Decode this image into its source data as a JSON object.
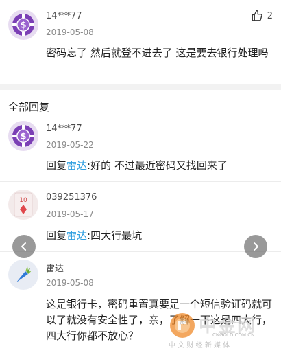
{
  "top_comment": {
    "username": "14***77",
    "date": "2019-05-08",
    "text": "密码忘了 然后就登不进去了 这是要去银行处理吗",
    "like_count": "2"
  },
  "section_title": "全部回复",
  "replies": [
    {
      "username": "14***77",
      "date": "2019-05-22",
      "prefix": "回复",
      "mention": "雷达",
      "text": ":好的 不过最近密码又找回来了",
      "avatar_icon": "poker-chip-icon"
    },
    {
      "username": "039251376",
      "date": "2019-05-17",
      "prefix": "回复",
      "mention": "雷达",
      "text": ":四大行最坑",
      "avatar_icon": "playing-card-icon",
      "avatar_card_rank": "10"
    },
    {
      "username": "雷达",
      "date": "2019-05-08",
      "text": "这是银行卡，密码重置真要是一个短信验证码就可以了就没有安全性了，亲，了解一下这是四大行，四大行你都不放心？",
      "avatar_icon": "carrot-icon"
    }
  ],
  "watermark": {
    "brand": "中金网",
    "domain": "CNGOLD.COM.CN",
    "slogan": "中 文 财 经 新 媒 体"
  },
  "colors": {
    "mention": "#2f9fe0",
    "chip": "#7b3fb5"
  }
}
